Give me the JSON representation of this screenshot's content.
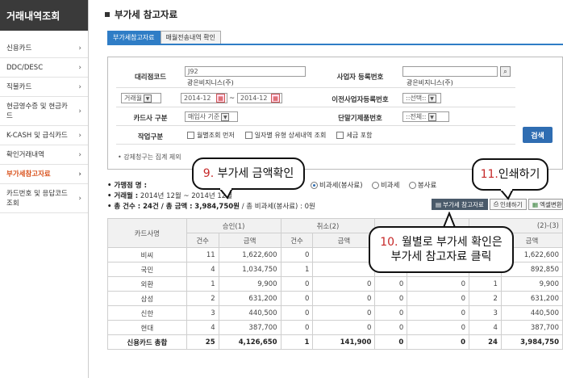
{
  "sidebar": {
    "title": "거래내역조회",
    "items": [
      {
        "label": "신용카드",
        "arrow": "›"
      },
      {
        "label": "DDC/DESC",
        "arrow": "›"
      },
      {
        "label": "직불카드",
        "arrow": "›"
      },
      {
        "label": "현금영수증 및 현금카드",
        "arrow": "›"
      },
      {
        "label": "K-CASH 및 급식카드",
        "arrow": "›"
      },
      {
        "label": "확인거래내역",
        "arrow": "›"
      },
      {
        "label": "부가세참고자료",
        "arrow": "›"
      },
      {
        "label": "카드번호 및 응답코드 조회",
        "arrow": "›"
      }
    ]
  },
  "page": {
    "title": "부가세 참고자료",
    "tabs": [
      "부가세참고자료",
      "매월전송내역 확인"
    ]
  },
  "filter": {
    "agency_code_label": "대리점코드",
    "agency_code_value": "J92",
    "agency_name": "광은비지니스(주)",
    "biz_reg_label": "사업자 등록번호",
    "biz_reg_name": "광은비지니스(주)",
    "period_type": "거래월",
    "date_from": "2014-12",
    "date_sep": "~",
    "date_to": "2014-12",
    "prev_biz_label": "이전사업자등록번호",
    "prev_biz_value": "::선택::",
    "card_type_label": "카드사 구분",
    "card_type_value": "매입사 기준",
    "terminal_label": "단말기제품번호",
    "terminal_value": "::전체::",
    "work_label": "작업구분",
    "opt1": "월별조회 먼저",
    "opt2": "일자별 유형 상세내역 조회",
    "opt3": "세금 포함",
    "search_button": "검색",
    "note": "• 강제청구는 집계 제외"
  },
  "summary": {
    "tax_type_label": "• 가맹점 명 :",
    "period_label": "• 거래월 :",
    "period_value": "2014년 12월 ~ 2014년 12월",
    "count_label": "• 총 건수 : 24건 / 총 금액 :",
    "amount_value": "3,984,750원",
    "nontax_text": "/ 총 비과세(봉사료) : 0원",
    "radio1": "비과세(봉사료)",
    "radio2": "비과세",
    "radio3": "봉사료",
    "btn_vat": "부가세 참고자료",
    "btn_print": "인쇄하기",
    "btn_excel": "엑셀변환"
  },
  "table": {
    "h_card": "카드사명",
    "h_approve": "승인(1)",
    "h_cancel": "취소(2)",
    "h_net": "(2)-(3)",
    "h_count": "건수",
    "h_amount": "금액",
    "rows": [
      [
        "비씨",
        "11",
        "1,622,600",
        "0",
        "",
        "",
        "",
        "",
        "1,622,600"
      ],
      [
        "국민",
        "4",
        "1,034,750",
        "1",
        "",
        "",
        "",
        "",
        "892,850"
      ],
      [
        "외환",
        "1",
        "9,900",
        "0",
        "0",
        "0",
        "0",
        "1",
        "9,900"
      ],
      [
        "삼성",
        "2",
        "631,200",
        "0",
        "0",
        "0",
        "0",
        "2",
        "631,200"
      ],
      [
        "신한",
        "3",
        "440,500",
        "0",
        "0",
        "0",
        "0",
        "3",
        "440,500"
      ],
      [
        "현대",
        "4",
        "387,700",
        "0",
        "0",
        "0",
        "0",
        "4",
        "387,700"
      ]
    ],
    "total": [
      "신용카드 총합",
      "25",
      "4,126,650",
      "1",
      "141,900",
      "0",
      "0",
      "24",
      "3,984,750"
    ]
  },
  "callouts": {
    "c9_num": "9.",
    "c9_text": "부가세 금액확인",
    "c11_num": "11.",
    "c11_text": "인쇄하기",
    "c10_num": "10.",
    "c10_text1": "월별로 부가세 확인은",
    "c10_text2": "부가세 참고자료 클릭"
  }
}
